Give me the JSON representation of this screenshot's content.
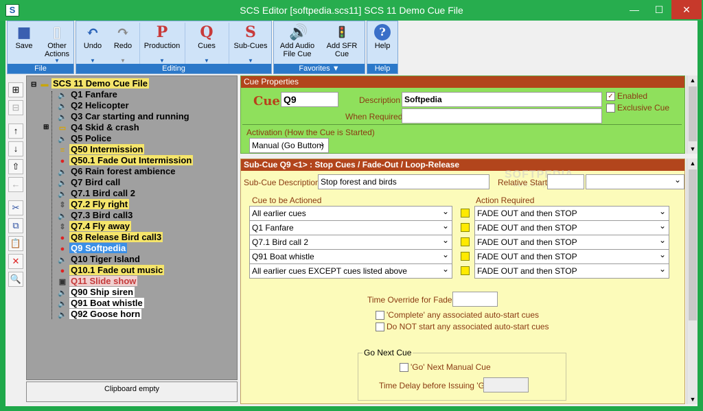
{
  "window": {
    "title": "SCS Editor  [softpedia.scs11]  SCS 11 Demo Cue File",
    "app_icon_text": "S",
    "min_label": "—",
    "max_label": "☐",
    "close_label": "✕"
  },
  "ribbon": {
    "groups": [
      "File",
      "Editing",
      "Favorites ▼",
      "Help"
    ],
    "buttons": {
      "save": "Save",
      "other_line1": "Other",
      "other_line2": "Actions",
      "undo": "Undo",
      "redo": "Redo",
      "production": "Production",
      "cues": "Cues",
      "subcues": "Sub-Cues",
      "add_audio_line1": "Add Audio",
      "add_audio_line2": "File Cue",
      "add_sfr_line1": "Add SFR",
      "add_sfr_line2": "Cue",
      "help": "Help"
    },
    "icons": {
      "production": "P",
      "cues": "Q",
      "subcues": "S"
    }
  },
  "tree": {
    "root": "SCS 11 Demo Cue File",
    "items": [
      {
        "label": "Q1 Fanfare",
        "icon": "speaker-icon",
        "hl": ""
      },
      {
        "label": "Q2 Helicopter",
        "icon": "speaker-icon",
        "hl": ""
      },
      {
        "label": "Q3 Car starting and running",
        "icon": "speaker-icon",
        "hl": ""
      },
      {
        "label": "Q4 Skid & crash",
        "icon": "folder-icon",
        "hl": ""
      },
      {
        "label": "Q5 Police",
        "icon": "speaker-icon",
        "hl": ""
      },
      {
        "label": "Q50 Intermission",
        "icon": "note-icon",
        "hl": "yellow"
      },
      {
        "label": "Q50.1 Fade Out Intermission",
        "icon": "traffic-light-icon",
        "hl": "yellow"
      },
      {
        "label": "Q6 Rain forest ambience",
        "icon": "speaker-icon",
        "hl": ""
      },
      {
        "label": "Q7 Bird call",
        "icon": "speaker-icon",
        "hl": ""
      },
      {
        "label": "Q7.1 Bird call 2",
        "icon": "speaker-icon",
        "hl": ""
      },
      {
        "label": "Q7.2 Fly right",
        "icon": "slider-icon",
        "hl": "yellow"
      },
      {
        "label": "Q7.3 Bird call3",
        "icon": "speaker-icon",
        "hl": ""
      },
      {
        "label": "Q7.4 Fly away",
        "icon": "slider-icon",
        "hl": "yellow"
      },
      {
        "label": "Q8 Release Bird call3",
        "icon": "traffic-light-icon",
        "hl": "yellow"
      },
      {
        "label": "Q9 Softpedia",
        "icon": "traffic-light-icon",
        "hl": "sel"
      },
      {
        "label": "Q10 Tiger Island",
        "icon": "speaker-icon",
        "hl": ""
      },
      {
        "label": "Q10.1 Fade out music",
        "icon": "traffic-light-icon",
        "hl": "yellow"
      },
      {
        "label": "Q11 Slide show",
        "icon": "slideshow-icon",
        "hl": "red"
      },
      {
        "label": "Q90 Ship siren",
        "icon": "speaker-icon",
        "hl": "white"
      },
      {
        "label": "Q91 Boat whistle",
        "icon": "speaker-icon",
        "hl": "white"
      },
      {
        "label": "Q92 Goose horn",
        "icon": "speaker-icon",
        "hl": "white"
      }
    ],
    "clipboard": "Clipboard empty"
  },
  "cue_props": {
    "header": "Cue Properties",
    "cue_label": "Cue",
    "cue_value": "Q9",
    "description_label": "Description",
    "description_value": "Softpedia",
    "when_required_label": "When Required",
    "when_required_value": "",
    "enabled_label": "Enabled",
    "exclusive_label": "Exclusive Cue",
    "activation_label": "Activation (How the Cue is Started)",
    "activation_value": "Manual (Go Button)"
  },
  "subcue": {
    "header": "Sub-Cue Q9 <1> : Stop Cues / Fade-Out / Loop-Release",
    "desc_label": "Sub-Cue Description",
    "desc_value": "Stop forest and birds",
    "relstart_label": "Relative Start",
    "relstart_value": "",
    "col_cue_label": "Cue to be Actioned",
    "col_action_label": "Action Required",
    "rows": [
      {
        "cue": "All earlier cues",
        "action": "FADE OUT and then STOP"
      },
      {
        "cue": "Q1  Fanfare",
        "action": "FADE OUT and then STOP"
      },
      {
        "cue": "Q7.1  Bird call 2",
        "action": "FADE OUT and then STOP"
      },
      {
        "cue": "Q91  Boat whistle",
        "action": "FADE OUT and then STOP"
      },
      {
        "cue": "All earlier cues EXCEPT cues listed above",
        "action": "FADE OUT and then STOP"
      }
    ],
    "time_override_label": "Time Override for Fades",
    "time_override_value": "",
    "complete_label": "'Complete' any associated auto-start cues",
    "donot_label": "Do NOT start any associated auto-start cues",
    "gonext_group": "Go Next Cue",
    "gonext_label": "'Go' Next Manual Cue",
    "delay_label": "Time Delay before Issuing 'Go'",
    "delay_value": ""
  },
  "watermark": {
    "text": "SOFTPEDIA",
    "url": "www.softpedia.com"
  }
}
